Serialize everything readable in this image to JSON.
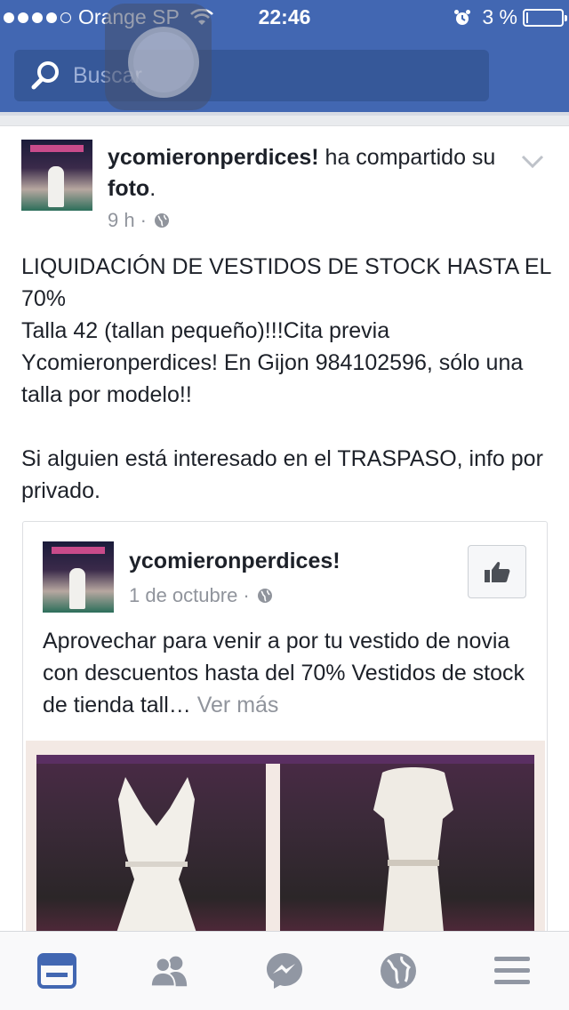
{
  "status_bar": {
    "carrier": "Orange SP",
    "time": "22:46",
    "battery": "3 %"
  },
  "search": {
    "placeholder": "Buscar"
  },
  "post": {
    "author": "ycomieronperdices!",
    "action_before": "ha compartido su",
    "action_object": "foto",
    "action_after": ".",
    "time": "9 h",
    "separator": "·",
    "paragraphs": [
      "LIQUIDACIÓN DE VESTIDOS DE STOCK HASTA EL 70%\nTalla 42 (tallan pequeño)!!!Cita previa Ycomieronperdices! En Gijon 984102596, sólo una talla por modelo!!",
      "Si alguien está interesado en el TRASPASO, info por privado."
    ],
    "shared": {
      "author": "ycomieronperdices!",
      "date": "1 de octubre",
      "separator": "·",
      "text": "Aprovechar para venir a por tu vestido de novia con descuentos hasta del 70% Vestidos de stock de tienda tall…",
      "see_more": "Ver más"
    }
  },
  "tabbar": {
    "items": [
      {
        "icon": "news-feed-icon",
        "active": true
      },
      {
        "icon": "friends-icon",
        "active": false
      },
      {
        "icon": "messenger-icon",
        "active": false
      },
      {
        "icon": "globe-notifications-icon",
        "active": false
      },
      {
        "icon": "menu-icon",
        "active": false
      }
    ]
  },
  "colors": {
    "header": "#4267b2",
    "active_tab": "#4267b2",
    "inactive_tab": "#9197a3"
  }
}
